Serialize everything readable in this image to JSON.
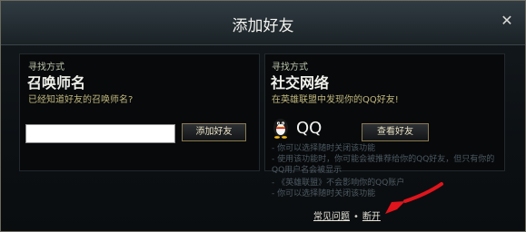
{
  "dialog": {
    "title": "添加好友",
    "close_symbol": "✕"
  },
  "left": {
    "mode_label": "寻找方式",
    "heading": "召唤师名",
    "subtitle": "已经知道好友的召唤师名?",
    "input_value": "",
    "button_label": "添加好友"
  },
  "right": {
    "mode_label": "寻找方式",
    "heading": "社交网络",
    "subtitle": "在英雄联盟中发现你的QQ好友!",
    "qq_label": "QQ",
    "qq_icon": "qq-penguin-icon",
    "button_label": "查看好友",
    "info_lines": [
      "- 你可以选择随时关闭该功能",
      "- 使用该功能时，你可能会被推荐给你的QQ好友，但只有你的",
      "QQ用户名会被显示",
      "- 《英雄联盟》不会影响你的QQ账户",
      "- 你可以选择随时关闭该功能"
    ]
  },
  "footer": {
    "faq_label": "常见问题",
    "separator": "•",
    "open_label": "断开"
  },
  "colors": {
    "accent_gold": "#c0b77c",
    "arrow_red": "#e0141c"
  }
}
